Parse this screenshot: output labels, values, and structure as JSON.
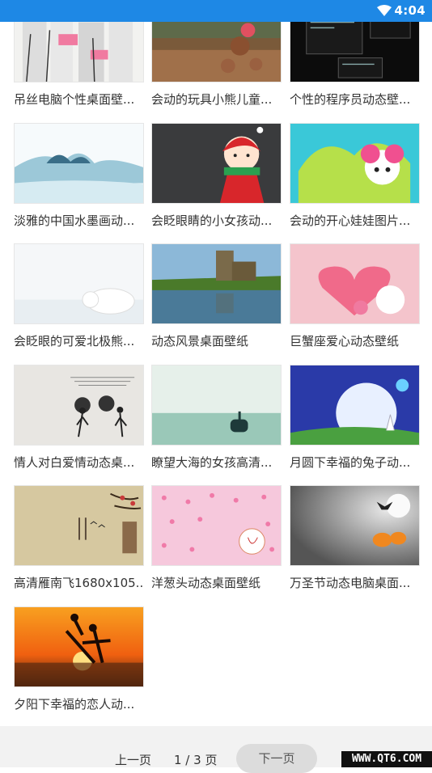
{
  "status_bar": {
    "time": "4:04",
    "wifi_icon": "wifi-icon"
  },
  "wallpapers": [
    {
      "title": "吊丝电脑个性桌面壁..."
    },
    {
      "title": "会动的玩具小熊儿童..."
    },
    {
      "title": "个性的程序员动态壁..."
    },
    {
      "title": "淡雅的中国水墨画动..."
    },
    {
      "title": "会眨眼睛的小女孩动..."
    },
    {
      "title": "会动的开心娃娃图片..."
    },
    {
      "title": "会眨眼的可爱北极熊..."
    },
    {
      "title": "动态风景桌面壁纸"
    },
    {
      "title": "巨蟹座爱心动态壁纸"
    },
    {
      "title": "情人对白爱情动态桌..."
    },
    {
      "title": "瞭望大海的女孩高清..."
    },
    {
      "title": "月圆下幸福的兔子动..."
    },
    {
      "title": "高清雁南飞1680x105..."
    },
    {
      "title": "洋葱头动态桌面壁纸"
    },
    {
      "title": "万圣节动态电脑桌面..."
    },
    {
      "title": "夕阳下幸福的恋人动..."
    }
  ],
  "pagination": {
    "prev_label": "上一页",
    "page_indicator": "1 / 3 页",
    "next_label": "下一页"
  },
  "watermark": "WWW.QT6.COM"
}
